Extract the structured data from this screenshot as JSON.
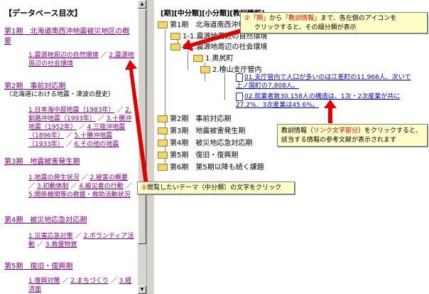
{
  "left_panel": {
    "header": "【データベース目次】",
    "periods": [
      {
        "title": "第1期　北海道南西沖地震被災地区の概要",
        "items": [
          "1.震源地周辺の自然環境",
          "2.震源地周辺の社会環境"
        ]
      },
      {
        "title": "第2期　事前対応期",
        "subtitle": "（北海道における地震・津波の歴史）",
        "items": [
          "1.日本海中部地震（1983年）",
          "2.釧路沖地震（1993年）",
          "3.十勝沖地震（1952年）",
          "4.三陸沖地震（1896年）",
          "5.十勝沖地震（1933年）",
          "6.その他の地震"
        ]
      },
      {
        "title": "第3期　地震被害発生期",
        "items": [
          "1.地震の発生状況",
          "2.被害の概要",
          "3.初動体制",
          "4.被災者の行動",
          "5.関係機関等の救援・救助活動状況"
        ]
      },
      {
        "title": "第4期　被災地応急対応期",
        "items": [
          "1.災害応急対策",
          "2.ボランティア活動",
          "3.救援物資"
        ]
      },
      {
        "title": "第5期　復旧・復興期",
        "items": [
          "1.復興対策",
          "2.まちづくり",
          "3.経済面"
        ]
      }
    ]
  },
  "right_panel": {
    "header": "[期][中分類][小分類][教訓情報]",
    "tree": {
      "p1": "第1期　北海道南西沖地震",
      "c1": "1-1.震源地周辺の自然環境",
      "c2": "1-2.震源地周辺の社会環境",
      "s1": "1.奥尻町",
      "s2": "2.檜山支庁管内",
      "info1": "01.支庁管内で人口が多いのは江差町の11,966人、次いで上ノ国町の7,808人。",
      "info2": "02.就業者数30,158人の構造は、1次・2次産業が共に27.2%、3次産業は45.6%。",
      "p2": "第2期　事前対応期",
      "p3": "第3期　地震被害発生期",
      "p4": "第4期　被災地応急対応期",
      "p5": "第5期　復旧・復興期",
      "p6": "第6期　第5期以降も続く課題"
    }
  },
  "callouts": {
    "c1": {
      "num": "②",
      "q1": "「期」",
      "t1": "から",
      "q2": "「教訓情報」",
      "t2": "まで、各左側のアイコンを",
      "t3": "クリックすると、その細分類が表示"
    },
    "c2": {
      "t1": "教訓情報（",
      "r1": "リンク文字部分",
      "t2": "）をクリックすると、",
      "t3": "該当する情報の参考文献が表示されます"
    },
    "c3": {
      "num": "①",
      "t1": "閲覧したいテーマ（中分類）の文字をクリック"
    }
  },
  "colors": {
    "link": "#0000cc",
    "visited": "#800080",
    "arrow": "#e00000",
    "callout_bg": "#ffffc8"
  }
}
